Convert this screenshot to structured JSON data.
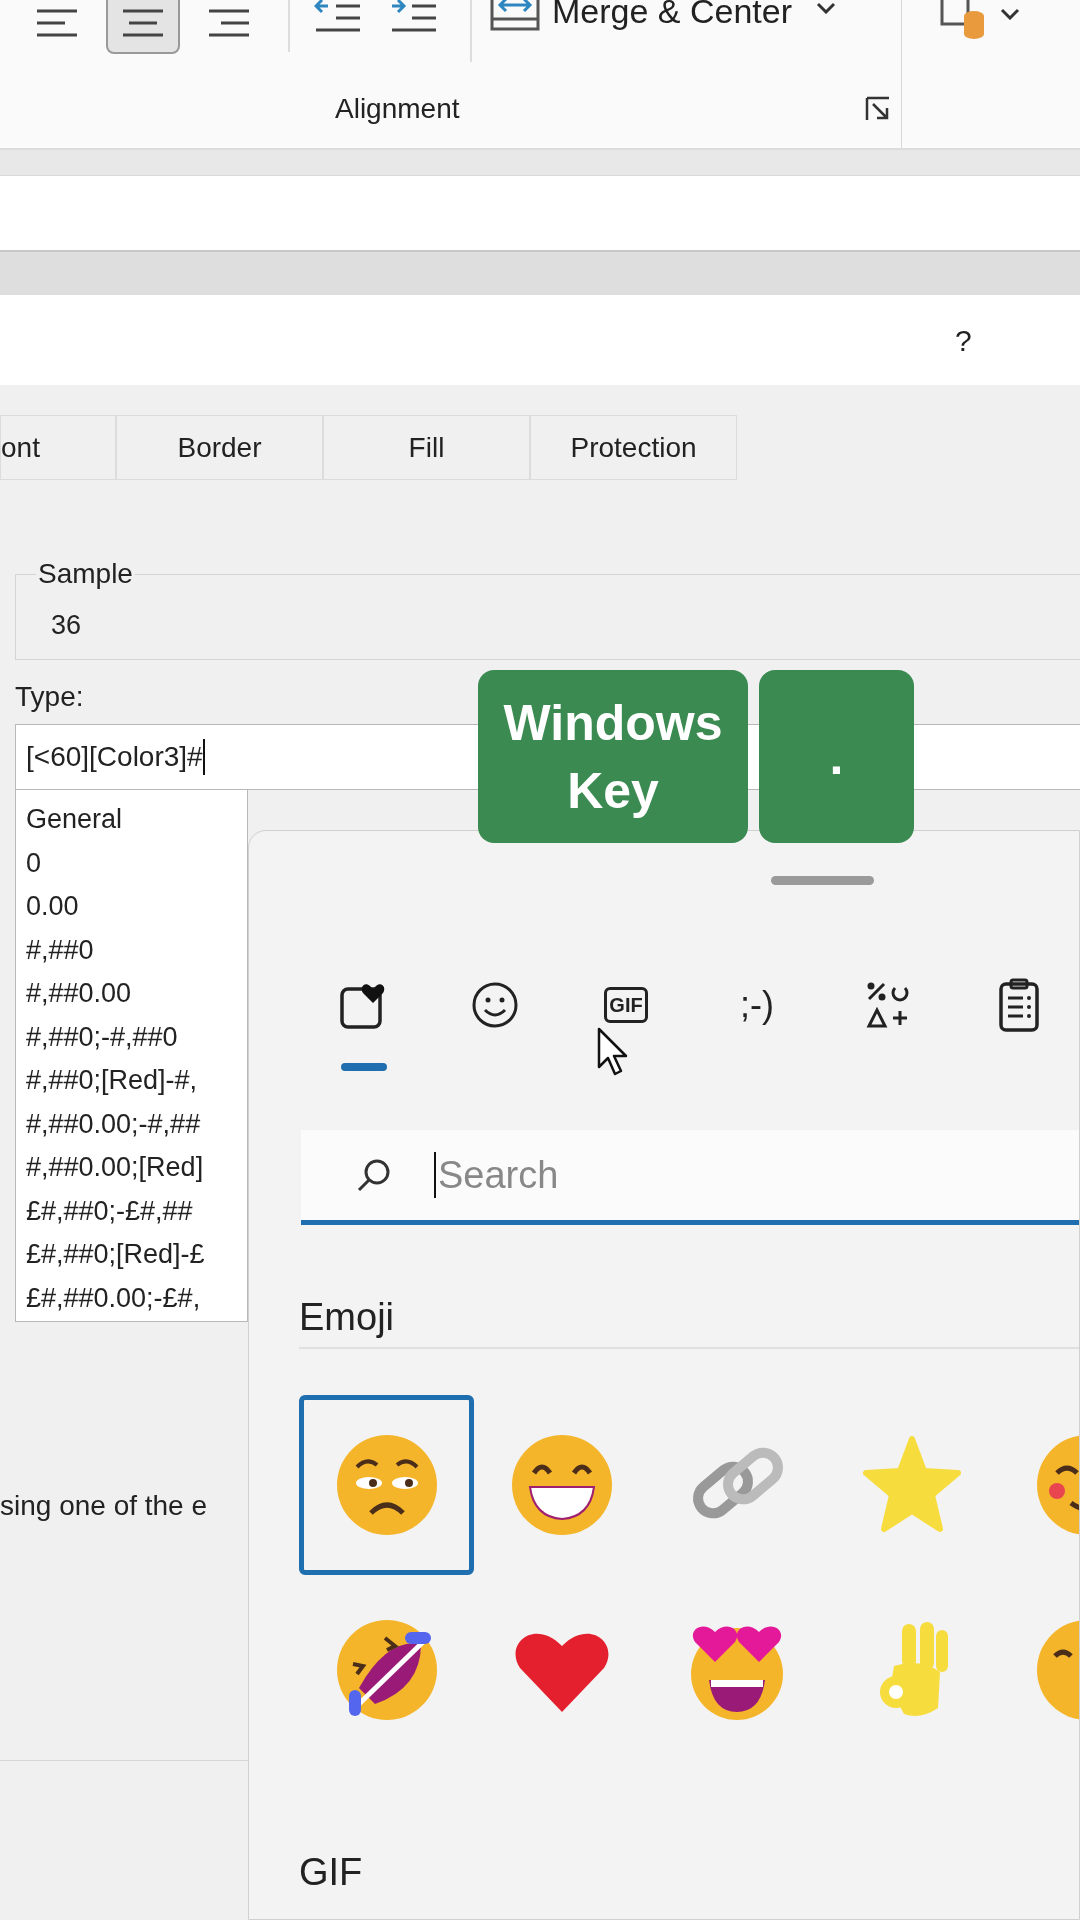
{
  "ribbon": {
    "alignment_buttons": [
      {
        "kind": "left",
        "selected": false
      },
      {
        "kind": "center",
        "selected": true
      },
      {
        "kind": "right",
        "selected": false
      }
    ],
    "merge_button": "Merge & Center",
    "group_label": "Alignment"
  },
  "dialog": {
    "help": "?",
    "tabs": [
      {
        "label": "ont",
        "selected": false
      },
      {
        "label": "Border",
        "selected": false
      },
      {
        "label": "Fill",
        "selected": false
      },
      {
        "label": "Protection",
        "selected": false
      }
    ],
    "sample_label": "Sample",
    "sample_value": "36",
    "type_label": "Type:",
    "type_value": "[<60][Color3]#",
    "formats": [
      "General",
      "0",
      "0.00",
      "#,##0",
      "#,##0.00",
      "#,##0;-#,##0",
      "#,##0;[Red]-#,",
      "#,##0.00;-#,##",
      "#,##0.00;[Red]",
      "£#,##0;-£#,##",
      "£#,##0;[Red]-£",
      "£#,##0.00;-£#,"
    ],
    "hint": "sing one of the e"
  },
  "keys": [
    {
      "label": "Windows Key"
    },
    {
      "label": "."
    }
  ],
  "emoji_panel": {
    "categories": [
      {
        "kind": "favorites",
        "selected": true
      },
      {
        "kind": "emoji",
        "selected": false
      },
      {
        "kind": "gif",
        "label": "GIF",
        "selected": false
      },
      {
        "kind": "kaomoji",
        "label": ";-)",
        "selected": false
      },
      {
        "kind": "symbols",
        "selected": false
      },
      {
        "kind": "clipboard",
        "selected": false
      }
    ],
    "search_placeholder": "Search",
    "section": "Emoji",
    "emoji": [
      {
        "kind": "weary",
        "selected": true
      },
      {
        "kind": "grin",
        "selected": false
      },
      {
        "kind": "link",
        "selected": false
      },
      {
        "kind": "star",
        "selected": false
      },
      {
        "kind": "blush",
        "selected": false
      },
      {
        "kind": "rofl",
        "selected": false
      },
      {
        "kind": "heart",
        "selected": false
      },
      {
        "kind": "heart_eyes",
        "selected": false
      },
      {
        "kind": "ok_hand",
        "selected": false
      },
      {
        "kind": "smile",
        "selected": false
      }
    ],
    "next_section": "GIF"
  }
}
